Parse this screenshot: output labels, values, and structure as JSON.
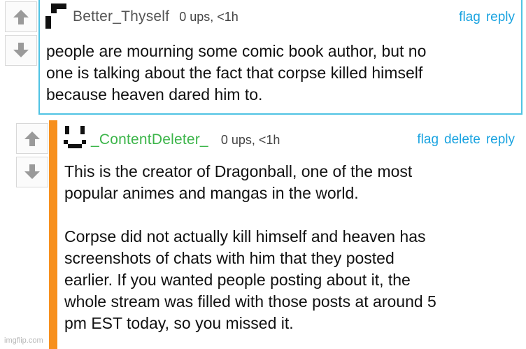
{
  "comments": [
    {
      "username": "Better_Thyself",
      "meta": "0 ups, <1h",
      "actions": [
        "flag",
        "reply"
      ],
      "body": [
        "people are mourning some comic book author, but no",
        "one is talking about the fact that corpse killed himself",
        "because heaven dared him to."
      ],
      "username_color": "#555555"
    },
    {
      "username": "_ContentDeleter_",
      "meta": "0 ups, <1h",
      "actions": [
        "flag",
        "delete",
        "reply"
      ],
      "body": [
        "This is the creator of Dragonball, one of the most",
        "popular animes and mangas in the world.",
        "",
        "Corpse did not actually kill himself and heaven has",
        "screenshots of chats with him that they posted",
        "earlier. If you wanted people posting about it, the",
        "whole stream was filled with those posts at around 5",
        "pm EST today, so you missed it."
      ],
      "username_color": "#3cb54a"
    }
  ],
  "icons": {
    "upvote": "arrow-up-icon",
    "downvote": "arrow-down-icon"
  },
  "watermark": "imgflip.com"
}
